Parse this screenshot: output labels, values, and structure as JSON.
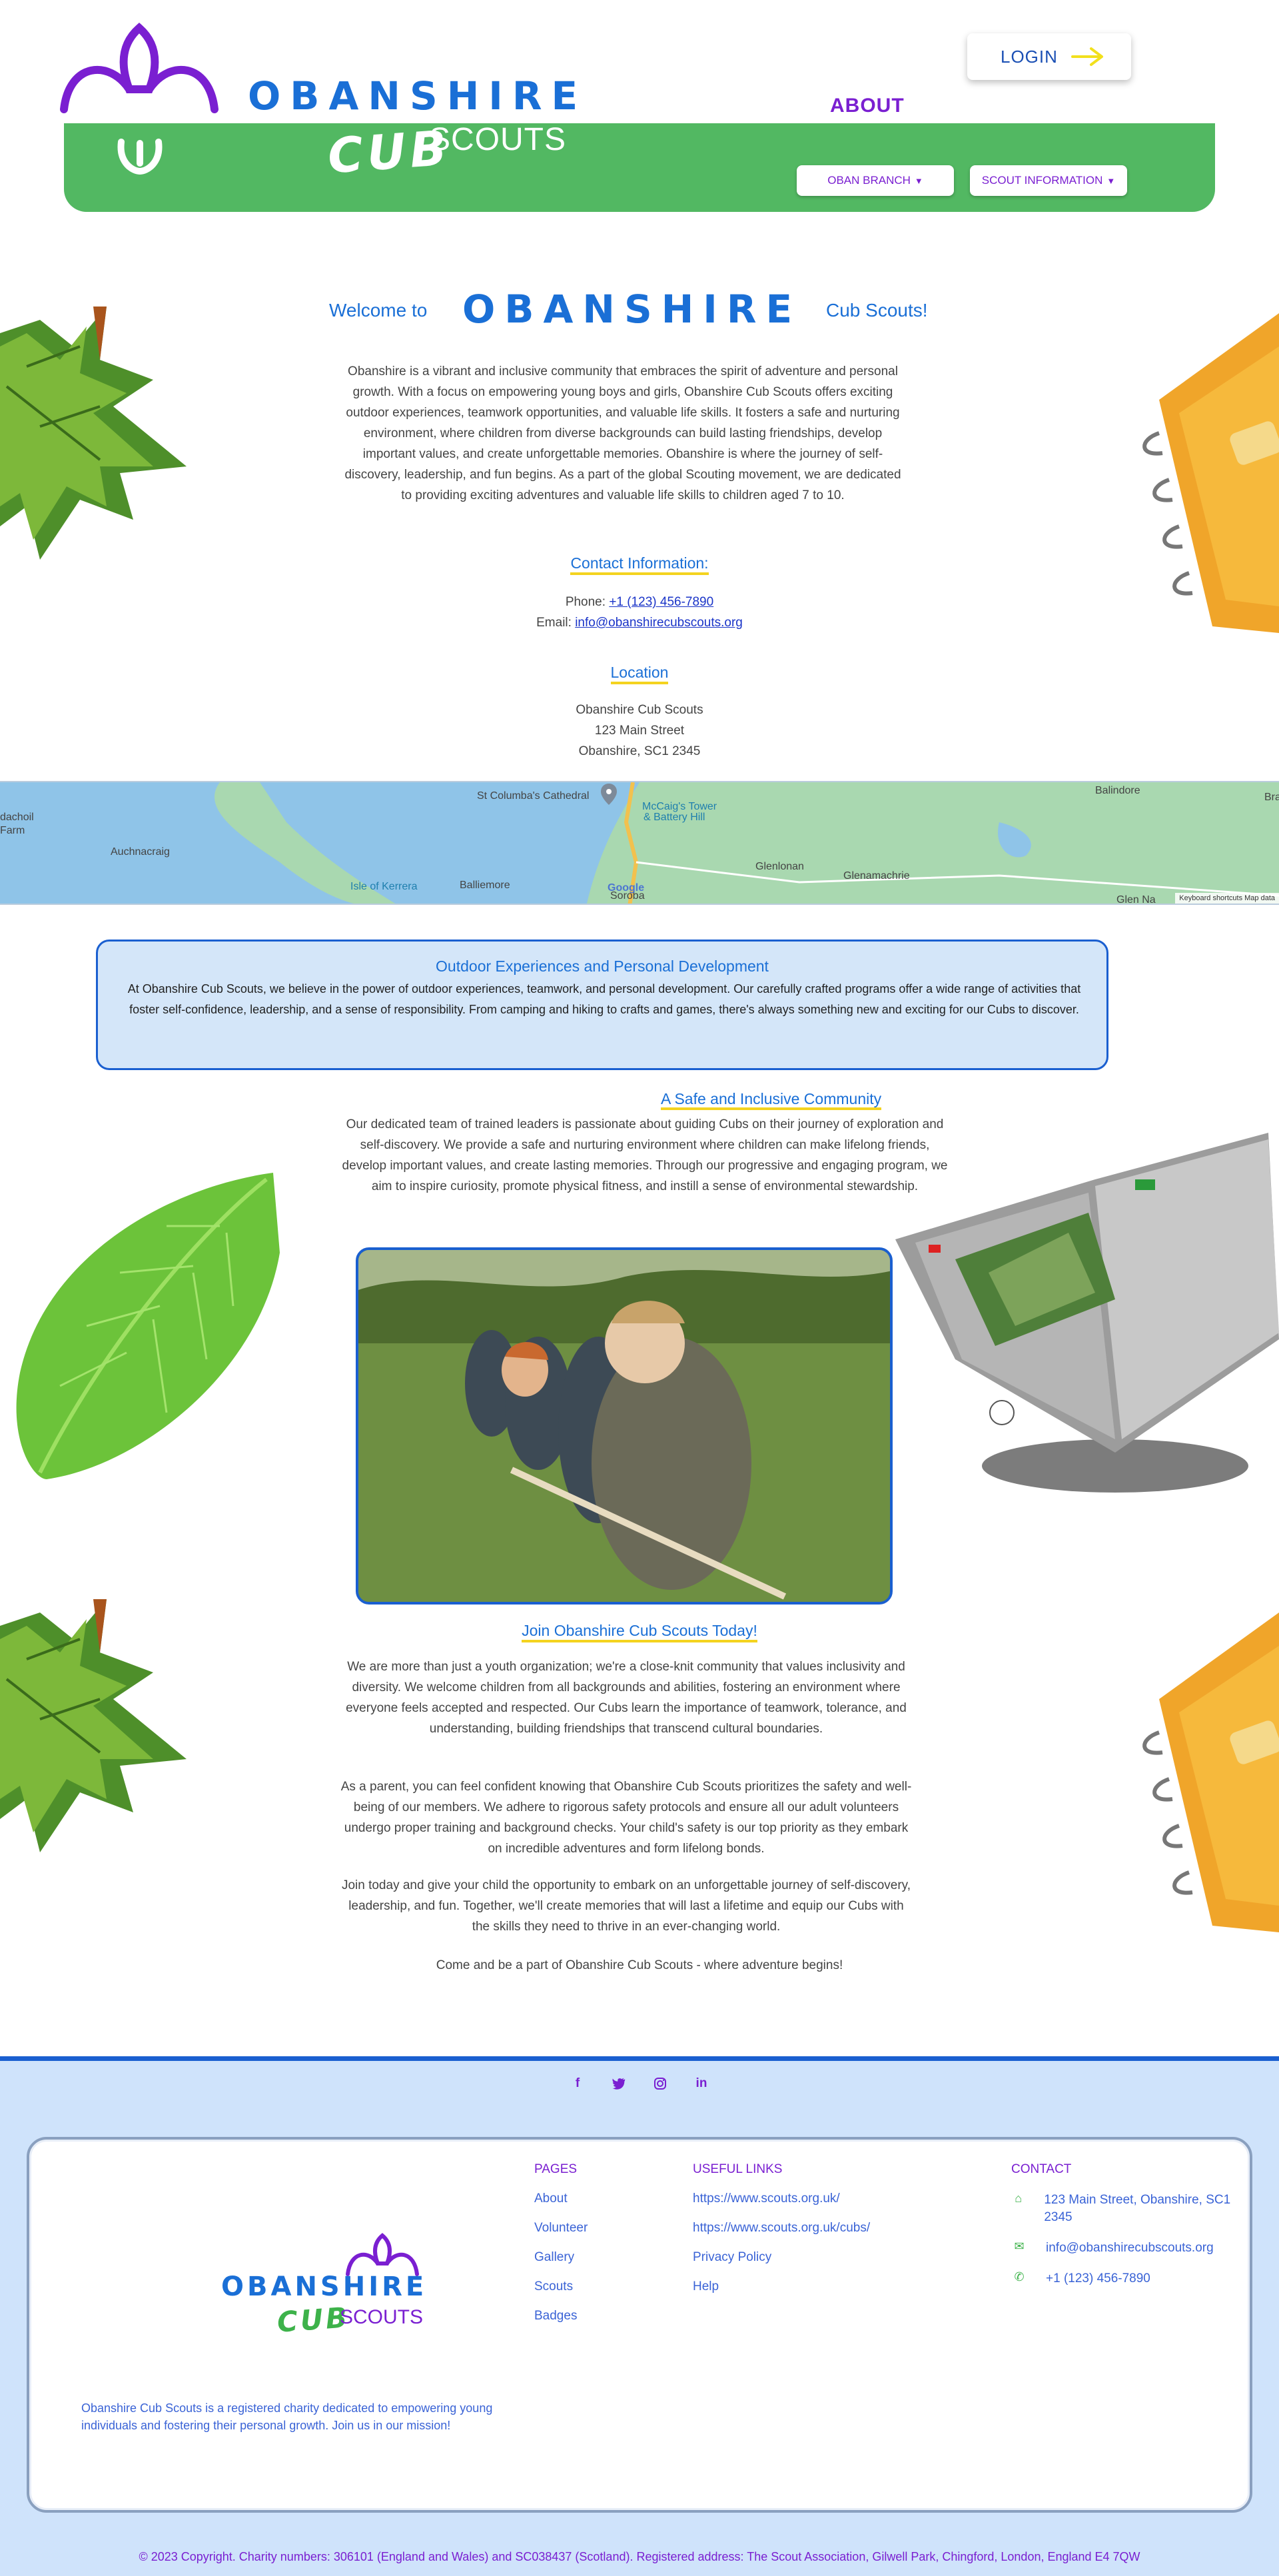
{
  "header": {
    "brand_title": "OBANSHIRE",
    "brand_cub": "CUB",
    "brand_scouts": "SCOUTS",
    "login_label": "LOGIN",
    "about_label": "ABOUT",
    "menu": [
      {
        "label": "OBAN BRANCH"
      },
      {
        "label": "SCOUT INFORMATION"
      }
    ]
  },
  "welcome": {
    "pre": "Welcome to",
    "name": "OBANSHIRE",
    "post": "Cub Scouts!",
    "intro": "Obanshire is a vibrant and inclusive community that embraces the spirit of adventure and personal growth. With a focus on empowering young boys and girls, Obanshire Cub Scouts offers exciting outdoor experiences, teamwork opportunities, and valuable life skills. It fosters a safe and nurturing environment, where children from diverse backgrounds can build lasting friendships, develop important values, and create unforgettable memories. Obanshire is where the journey of self-discovery, leadership, and fun begins. As a part of the global Scouting movement, we are dedicated to providing exciting adventures and valuable life skills to children aged 7 to 10."
  },
  "contact": {
    "heading": "Contact Information:",
    "phone_label": "Phone: ",
    "phone": "+1 (123) 456-7890",
    "email_label": "Email: ",
    "email": "info@obanshirecubscouts.org"
  },
  "location": {
    "heading": "Location",
    "line1": "Obanshire Cub Scouts",
    "line2": "123 Main Street",
    "line3": "Obanshire, SC1 2345"
  },
  "map": {
    "labels": [
      "Balindore",
      "Bra",
      "dachoil",
      "Farm",
      "Auchnacraig",
      "St Columba's Cathedral",
      "McCaig's Tower",
      "& Battery Hill",
      "Isle of Kerrera",
      "Balliemore",
      "Glenlonan",
      "Glenamachrie",
      "Soroba",
      "Glen Na"
    ],
    "attribution": "Keyboard shortcuts   Map data",
    "google": "Google"
  },
  "outdoor": {
    "title": "Outdoor Experiences and Personal Development",
    "text": "At Obanshire Cub Scouts, we believe in the power of outdoor experiences, teamwork, and personal development. Our carefully crafted programs offer a wide range of activities that foster self-confidence, leadership, and a sense of responsibility. From camping and hiking to crafts and games, there's always something new and exciting for our Cubs to discover."
  },
  "safe": {
    "heading": "A Safe and Inclusive Community",
    "text": "Our dedicated team of trained leaders is passionate about guiding Cubs on their journey of exploration and self-discovery. We provide a safe and nurturing environment where children can make lifelong friends, develop important values, and create lasting memories. Through our progressive and engaging program, we aim to inspire curiosity, promote physical fitness, and instill a sense of environmental stewardship."
  },
  "join": {
    "heading": "Join Obanshire Cub Scouts Today!",
    "p1": "We are more than just a youth organization; we're a close-knit community that values inclusivity and diversity. We welcome children from all backgrounds and abilities, fostering an environment where everyone feels accepted and respected. Our Cubs learn the importance of teamwork, tolerance, and understanding, building friendships that transcend cultural boundaries.",
    "p2": "As a parent, you can feel confident knowing that Obanshire Cub Scouts prioritizes the safety and well-being of our members. We adhere to rigorous safety protocols and ensure all our adult volunteers undergo proper training and background checks. Your child's safety is our top priority as they embark on incredible adventures and form lifelong bonds.",
    "p3": "Join today and give your child the opportunity to embark on an unforgettable journey of self-discovery, leadership, and fun. Together, we'll create memories that will last a lifetime and equip our Cubs with the skills they need to thrive in an ever-changing world.",
    "p4": "Come and be a part of Obanshire Cub Scouts - where adventure begins!"
  },
  "footer": {
    "socials": [
      {
        "icon": "facebook-icon",
        "glyph": "f"
      },
      {
        "icon": "twitter-icon",
        "glyph": "✒"
      },
      {
        "icon": "instagram-icon",
        "glyph": "◎"
      },
      {
        "icon": "linkedin-icon",
        "glyph": "in"
      }
    ],
    "logo_title": "OBANSHIRE",
    "logo_cub": "CUB",
    "logo_scouts": "SCOUTS",
    "description": "Obanshire Cub Scouts is a registered charity dedicated to empowering young individuals and fostering their personal growth. Join us in our mission!",
    "pages_heading": "PAGES",
    "pages": [
      "About",
      "Volunteer",
      "Gallery",
      "Scouts",
      "Badges"
    ],
    "links_heading": "USEFUL LINKS",
    "links": [
      "https://www.scouts.org.uk/",
      "https://www.scouts.org.uk/cubs/",
      "Privacy Policy",
      "Help"
    ],
    "contact_heading": "CONTACT",
    "address": "123 Main Street, Obanshire, SC1 2345",
    "email": "info@obanshirecubscouts.org",
    "phone": "+1 (123) 456-7890",
    "copyright": "© 2023 Copyright. Charity numbers: 306101 (England and Wales) and SC038437 (Scotland). Registered address: The Scout Association, Gilwell Park, Chingford, London, England E4 7QW"
  },
  "colors": {
    "brand_blue": "#1a6fd6",
    "brand_green": "#52b862",
    "brand_purple": "#7a1fd1",
    "accent_yellow": "#f4d31f",
    "footer_bg": "#cfe3fb"
  }
}
